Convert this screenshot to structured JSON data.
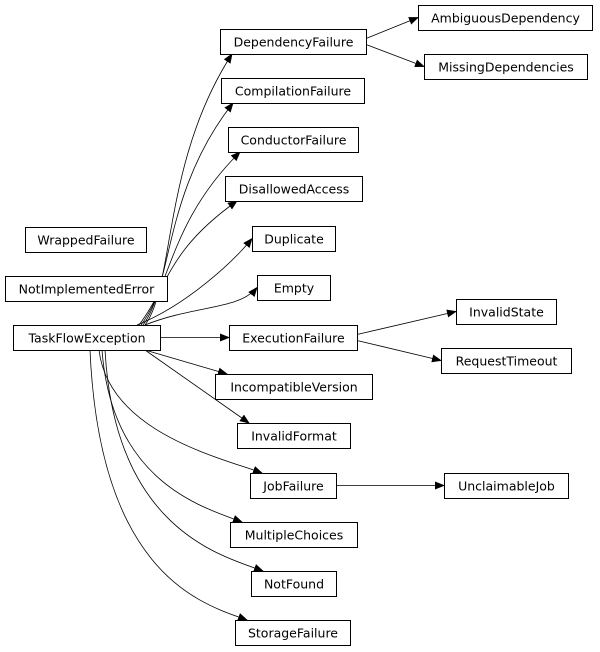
{
  "diagram": {
    "type": "inheritance-graph",
    "nodes": [
      {
        "id": "TaskFlowException",
        "label": "TaskFlowException"
      },
      {
        "id": "WrappedFailure",
        "label": "WrappedFailure"
      },
      {
        "id": "NotImplementedError",
        "label": "NotImplementedError"
      },
      {
        "id": "DependencyFailure",
        "label": "DependencyFailure"
      },
      {
        "id": "AmbiguousDependency",
        "label": "AmbiguousDependency"
      },
      {
        "id": "MissingDependencies",
        "label": "MissingDependencies"
      },
      {
        "id": "CompilationFailure",
        "label": "CompilationFailure"
      },
      {
        "id": "ConductorFailure",
        "label": "ConductorFailure"
      },
      {
        "id": "DisallowedAccess",
        "label": "DisallowedAccess"
      },
      {
        "id": "Duplicate",
        "label": "Duplicate"
      },
      {
        "id": "Empty",
        "label": "Empty"
      },
      {
        "id": "ExecutionFailure",
        "label": "ExecutionFailure"
      },
      {
        "id": "InvalidState",
        "label": "InvalidState"
      },
      {
        "id": "RequestTimeout",
        "label": "RequestTimeout"
      },
      {
        "id": "IncompatibleVersion",
        "label": "IncompatibleVersion"
      },
      {
        "id": "InvalidFormat",
        "label": "InvalidFormat"
      },
      {
        "id": "JobFailure",
        "label": "JobFailure"
      },
      {
        "id": "UnclaimableJob",
        "label": "UnclaimableJob"
      },
      {
        "id": "MultipleChoices",
        "label": "MultipleChoices"
      },
      {
        "id": "NotFound",
        "label": "NotFound"
      },
      {
        "id": "StorageFailure",
        "label": "StorageFailure"
      }
    ],
    "edges": [
      {
        "from": "TaskFlowException",
        "to": "DependencyFailure"
      },
      {
        "from": "TaskFlowException",
        "to": "CompilationFailure"
      },
      {
        "from": "TaskFlowException",
        "to": "ConductorFailure"
      },
      {
        "from": "TaskFlowException",
        "to": "DisallowedAccess"
      },
      {
        "from": "TaskFlowException",
        "to": "Duplicate"
      },
      {
        "from": "TaskFlowException",
        "to": "Empty"
      },
      {
        "from": "TaskFlowException",
        "to": "ExecutionFailure"
      },
      {
        "from": "TaskFlowException",
        "to": "IncompatibleVersion"
      },
      {
        "from": "TaskFlowException",
        "to": "InvalidFormat"
      },
      {
        "from": "TaskFlowException",
        "to": "JobFailure"
      },
      {
        "from": "TaskFlowException",
        "to": "MultipleChoices"
      },
      {
        "from": "TaskFlowException",
        "to": "NotFound"
      },
      {
        "from": "TaskFlowException",
        "to": "StorageFailure"
      },
      {
        "from": "DependencyFailure",
        "to": "AmbiguousDependency"
      },
      {
        "from": "DependencyFailure",
        "to": "MissingDependencies"
      },
      {
        "from": "ExecutionFailure",
        "to": "InvalidState"
      },
      {
        "from": "ExecutionFailure",
        "to": "RequestTimeout"
      },
      {
        "from": "JobFailure",
        "to": "UnclaimableJob"
      }
    ]
  }
}
